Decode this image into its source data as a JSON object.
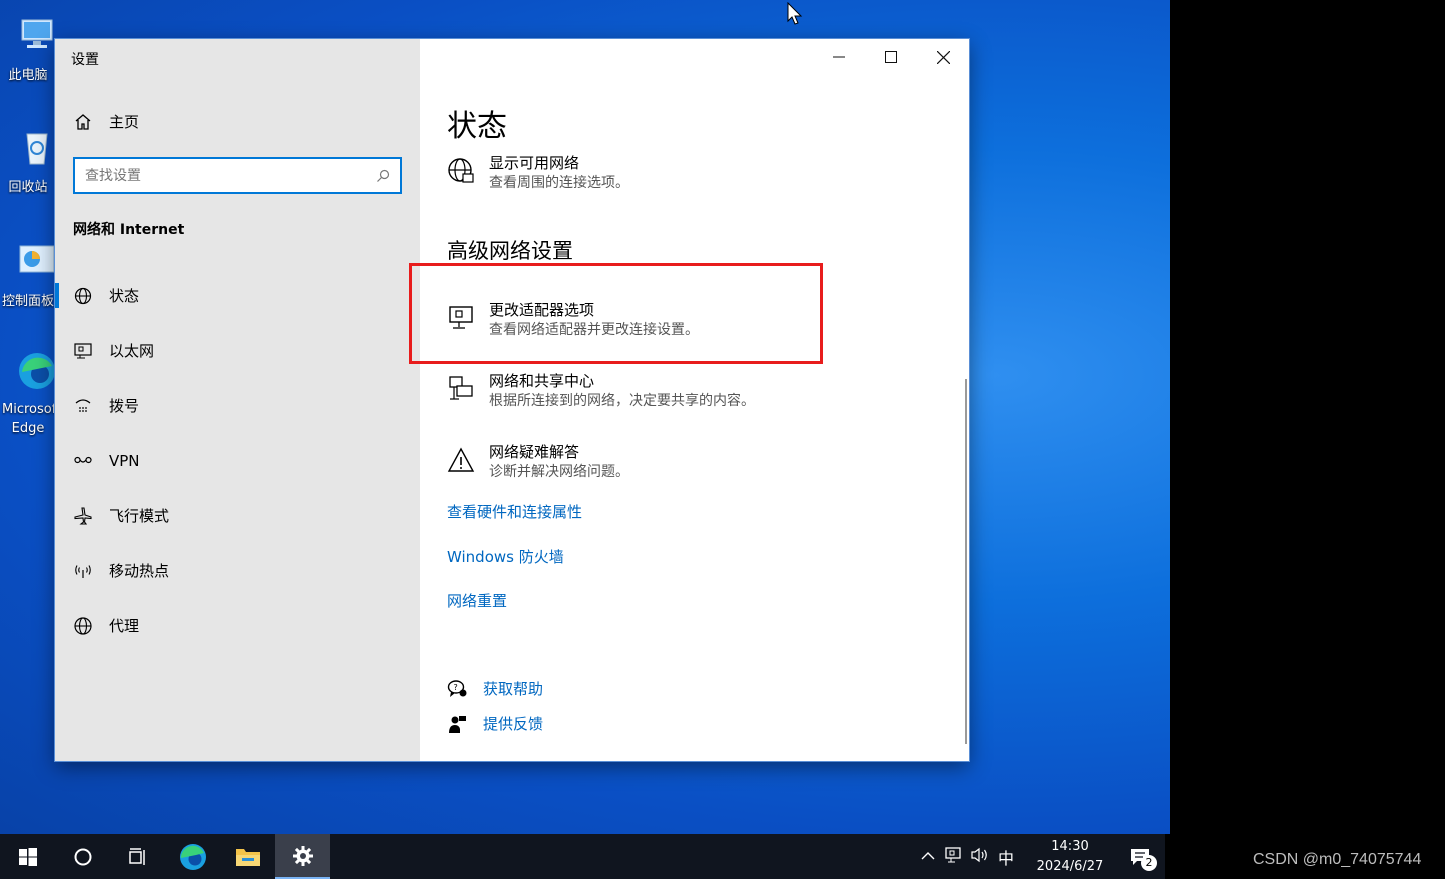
{
  "desktop": {
    "icons": [
      {
        "label": "此电脑"
      },
      {
        "label": "回收站"
      },
      {
        "label": "控制面板"
      },
      {
        "label": "Microsoft Edge"
      }
    ]
  },
  "window": {
    "title": "设置",
    "buttons": {
      "minimize": "—",
      "maximize": "☐",
      "close": "✕"
    }
  },
  "sidebar": {
    "home_label": "主页",
    "search_placeholder": "查找设置",
    "section_title": "网络和 Internet",
    "items": [
      {
        "label": "状态",
        "icon": "globe-status-icon",
        "active": true
      },
      {
        "label": "以太网",
        "icon": "ethernet-icon"
      },
      {
        "label": "拨号",
        "icon": "dialup-icon"
      },
      {
        "label": "VPN",
        "icon": "vpn-icon"
      },
      {
        "label": "飞行模式",
        "icon": "airplane-icon"
      },
      {
        "label": "移动热点",
        "icon": "hotspot-icon"
      },
      {
        "label": "代理",
        "icon": "proxy-globe-icon"
      }
    ]
  },
  "main": {
    "title": "状态",
    "show_networks": {
      "title": "显示可用网络",
      "desc": "查看周围的连接选项。"
    },
    "advanced_title": "高级网络设置",
    "items": [
      {
        "title": "更改适配器选项",
        "desc": "查看网络适配器并更改连接设置。"
      },
      {
        "title": "网络和共享中心",
        "desc": "根据所连接到的网络，决定要共享的内容。"
      },
      {
        "title": "网络疑难解答",
        "desc": "诊断并解决网络问题。"
      }
    ],
    "links": [
      "查看硬件和连接属性",
      "Windows 防火墙",
      "网络重置"
    ],
    "help": {
      "get_help": "获取帮助",
      "feedback": "提供反馈"
    }
  },
  "taskbar": {
    "ime": "中",
    "time": "14:30",
    "date": "2024/6/27",
    "notification_count": "2"
  },
  "watermark": "CSDN @m0_74075744",
  "colors": {
    "accent": "#0078d7",
    "link": "#0067c0",
    "highlight": "#e81c1c"
  }
}
